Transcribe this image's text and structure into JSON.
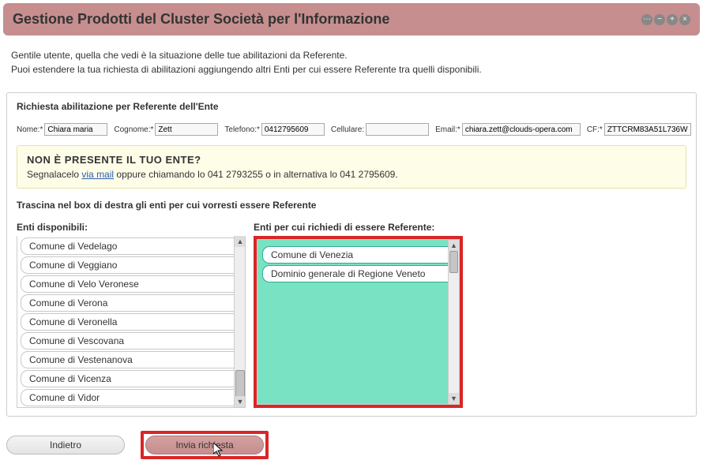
{
  "header": {
    "title": "Gestione Prodotti del Cluster Società per l'Informazione",
    "icons": {
      "a": "⋯",
      "b": "−",
      "c": "+",
      "d": "×"
    }
  },
  "intro": {
    "line1": "Gentile utente, quella che vedi è la situazione delle tue abilitazioni da Referente.",
    "line2": "Puoi estendere la tua richiesta di abilitazioni aggiungendo altri Enti per cui essere Referente tra quelli disponibili."
  },
  "panel_title": "Richiesta abilitazione per Referente dell'Ente",
  "form": {
    "nome_label": "Nome:*",
    "nome": "Chiara maria",
    "cognome_label": "Cognome:*",
    "cognome": "Zett",
    "telefono_label": "Telefono:*",
    "telefono": "0412795609",
    "cellulare_label": "Cellulare:",
    "cellulare": "",
    "email_label": "Email:*",
    "email": "chiara.zett@clouds-opera.com",
    "cf_label": "CF:*",
    "cf": "ZTTCRM83A51L736W"
  },
  "notice": {
    "title": "NON È PRESENTE IL TUO ENTE?",
    "pre": "Segnalacelo ",
    "link": "via mail",
    "post": " oppure chiamando lo 041 2793255 o in alternativa lo 041 2795609."
  },
  "drag_instruction": "Trascina nel box di destra gli enti per cui vorresti essere Referente",
  "left": {
    "title": "Enti disponibili:",
    "items": [
      "Comune di Vedelago",
      "Comune di Veggiano",
      "Comune di Velo Veronese",
      "Comune di Verona",
      "Comune di Veronella",
      "Comune di Vescovana",
      "Comune di Vestenanova",
      "Comune di Vicenza",
      "Comune di Vidor"
    ]
  },
  "right": {
    "title": "Enti per cui richiedi di essere Referente:",
    "items": [
      "Comune di Venezia",
      "Dominio generale di Regione Veneto"
    ]
  },
  "buttons": {
    "back": "Indietro",
    "submit": "Invia richiesta"
  }
}
